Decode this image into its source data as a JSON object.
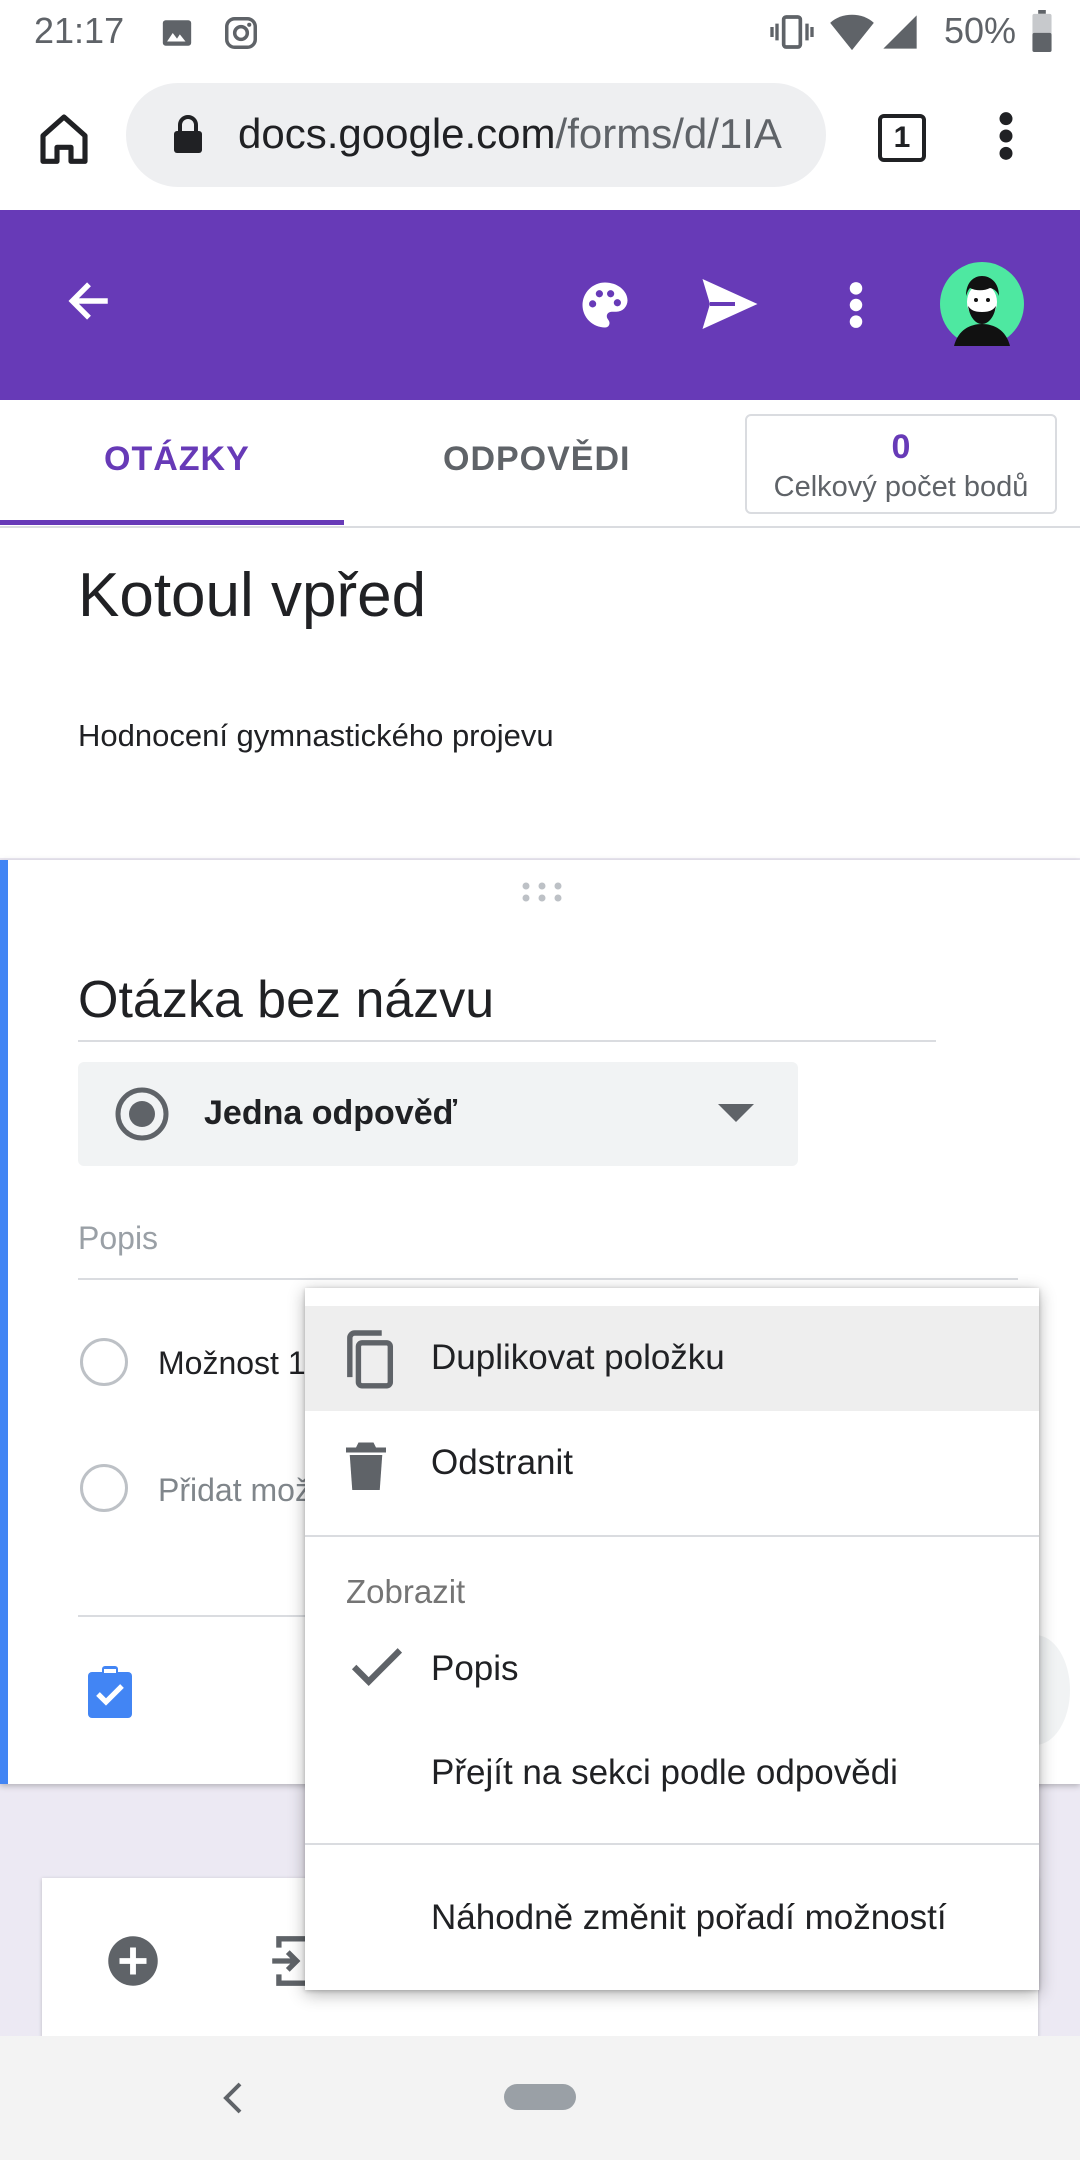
{
  "status_bar": {
    "time": "21:17",
    "battery": "50%"
  },
  "browser": {
    "url_host": "docs.google.com",
    "url_path": "/forms/d/1IA",
    "tab_count": "1"
  },
  "tabs": {
    "questions": "OTÁZKY",
    "responses": "ODPOVĚDI",
    "points_value": "0",
    "points_label": "Celkový počet bodů"
  },
  "form": {
    "title": "Kotoul vpřed",
    "description": "Hodnocení gymnastického projevu"
  },
  "question": {
    "title": "Otázka bez názvu",
    "type": "Jedna odpověď",
    "description_placeholder": "Popis",
    "option_1": "Možnost 1",
    "add_option": "Přidat možnost"
  },
  "menu": {
    "duplicate": "Duplikovat položku",
    "delete": "Odstranit",
    "section_show": "Zobrazit",
    "description": "Popis",
    "go_to_section": "Přejít na sekci podle odpovědi",
    "shuffle": "Náhodně změnit pořadí možností"
  },
  "colors": {
    "accent": "#673ab7",
    "question_bar": "#4285f4"
  },
  "icons": [
    "gallery-icon",
    "instagram-icon",
    "vibrate-icon",
    "wifi-icon",
    "signal-icon",
    "battery-icon",
    "home-icon",
    "lock-icon",
    "tabs-icon",
    "more-vert-icon",
    "back-arrow-icon",
    "palette-icon",
    "send-icon",
    "avatar",
    "drag-handle-icon",
    "radio-icon",
    "dropdown-arrow-icon",
    "quiz-key-icon",
    "copy-icon",
    "trash-icon",
    "check-icon",
    "add-circle-icon",
    "import-icon",
    "nav-back-icon"
  ]
}
